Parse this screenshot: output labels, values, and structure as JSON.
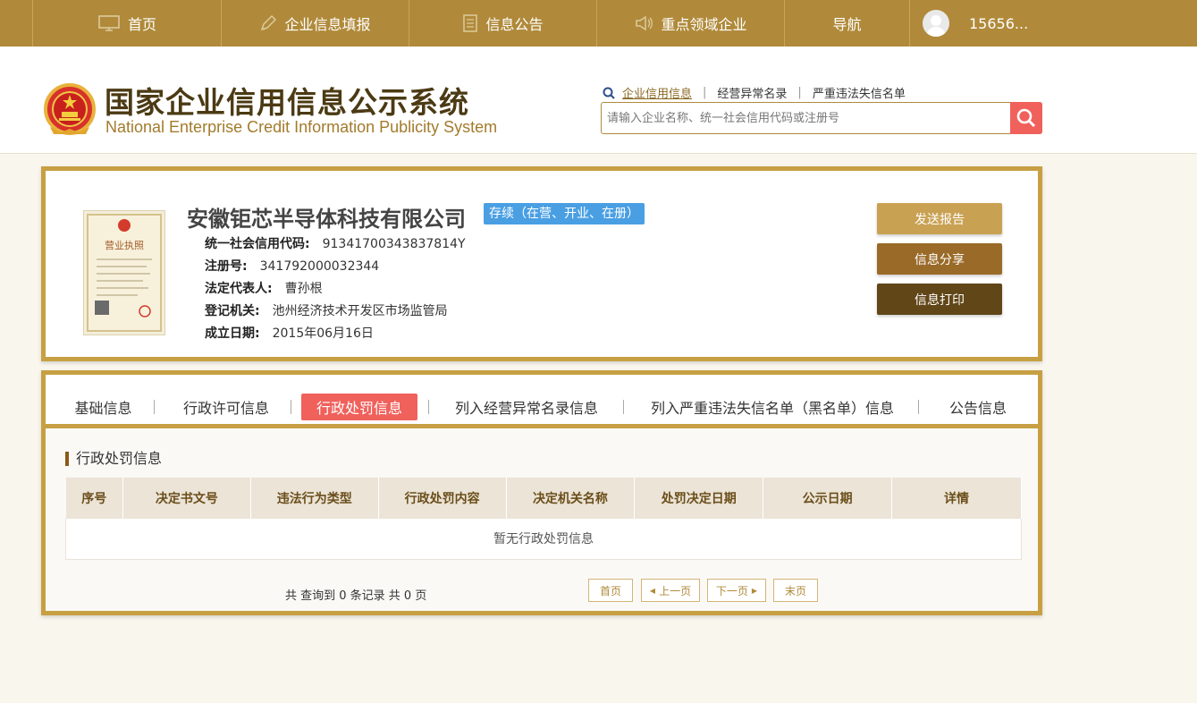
{
  "topnav": {
    "items": [
      {
        "label": "首页",
        "icon": "monitor-icon"
      },
      {
        "label": "企业信息填报",
        "icon": "pen-icon"
      },
      {
        "label": "信息公告",
        "icon": "document-icon"
      },
      {
        "label": "重点领域企业",
        "icon": "speaker-icon"
      },
      {
        "label": "导航"
      }
    ],
    "user": "15656..."
  },
  "header": {
    "title_cn": "国家企业信用信息公示系统",
    "title_en": "National Enterprise Credit Information Publicity System",
    "search_links": [
      "企业信用信息",
      "经营异常名录",
      "严重违法失信名单"
    ],
    "search_placeholder": "请输入企业名称、统一社会信用代码或注册号"
  },
  "company": {
    "license_title": "营业执照",
    "name": "安徽钜芯半导体科技有限公司",
    "status": "存续（在营、开业、在册）",
    "fields": [
      {
        "label": "统一社会信用代码:",
        "value": "91341700343837814Y"
      },
      {
        "label": "注册号:",
        "value": "341792000032344"
      },
      {
        "label": "法定代表人:",
        "value": "曹孙根"
      },
      {
        "label": "登记机关:",
        "value": "池州经济技术开发区市场监管局"
      },
      {
        "label": "成立日期:",
        "value": "2015年06月16日"
      }
    ],
    "buttons": [
      "发送报告",
      "信息分享",
      "信息打印"
    ]
  },
  "tabs": [
    "基础信息",
    "行政许可信息",
    "行政处罚信息",
    "列入经营异常名录信息",
    "列入严重违法失信名单（黑名单）信息",
    "公告信息"
  ],
  "active_tab": "行政处罚信息",
  "section": {
    "title": "行政处罚信息",
    "columns": [
      "序号",
      "决定书文号",
      "违法行为类型",
      "行政处罚内容",
      "决定机关名称",
      "处罚决定日期",
      "公示日期",
      "详情"
    ],
    "empty_text": "暂无行政处罚信息"
  },
  "pager": {
    "summary": "共 查询到 0 条记录 共 0 页",
    "first": "首页",
    "prev": "上一页",
    "next": "下一页",
    "last": "末页"
  },
  "colors": {
    "nav_bg": "#b08a3a",
    "frame": "#c7a044",
    "accent_red": "#f0615c",
    "status_blue": "#4a9fe3"
  }
}
